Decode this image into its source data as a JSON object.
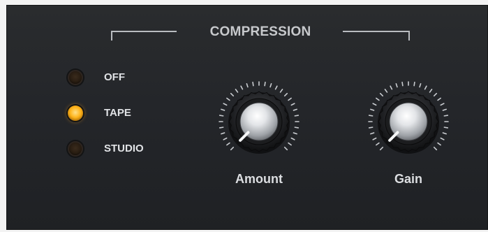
{
  "section": {
    "title": "COMPRESSION"
  },
  "modes": [
    {
      "label": "OFF",
      "active": false
    },
    {
      "label": "TAPE",
      "active": true
    },
    {
      "label": "STUDIO",
      "active": false
    }
  ],
  "knobs": [
    {
      "label": "Amount",
      "value": 0.0
    },
    {
      "label": "Gain",
      "value": 0.0
    }
  ],
  "colors": {
    "panel": "#25272a",
    "led_on": "#ffb51c",
    "led_off": "#2a1e12",
    "text": "#e1e3e6"
  }
}
